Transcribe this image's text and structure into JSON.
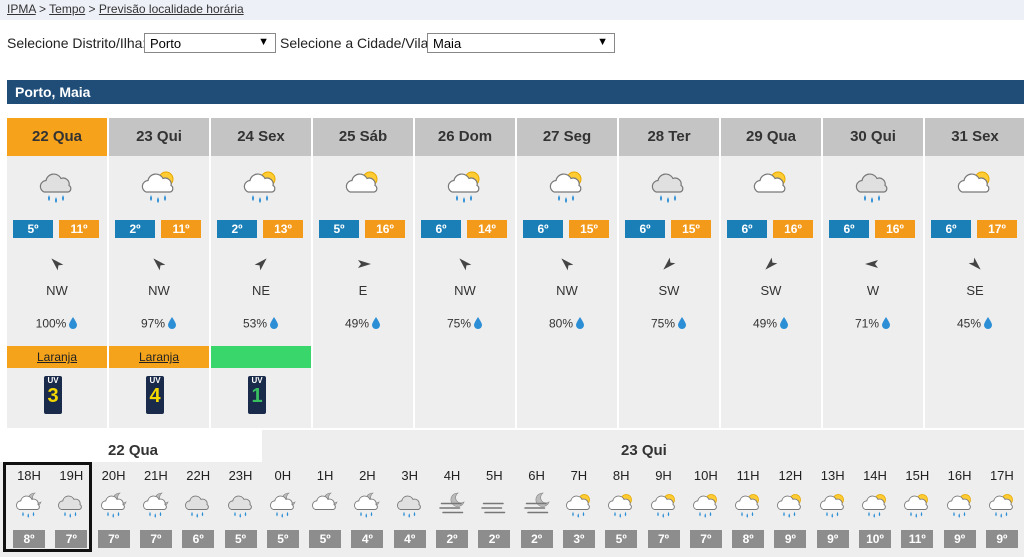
{
  "breadcrumb": {
    "items": [
      "IPMA",
      "Tempo",
      "Previsão localidade horária"
    ],
    "sep": ">"
  },
  "selectors": {
    "district_label": "Selecione Distrito/Ilha:",
    "district_value": "Porto",
    "city_label": "Selecione a Cidade/Vila:",
    "city_value": "Maia"
  },
  "location_title": "Porto, Maia",
  "colors": {
    "header_blue": "#1f4d78",
    "active_day": "#f7a21b",
    "tmin": "#1b7fb7",
    "tmax": "#f49a1b",
    "warn_orange": "#f5a31a",
    "warn_green": "#38d66b"
  },
  "days": [
    {
      "label": "22 Qua",
      "icon": "rain-cloud-icon",
      "tmin": "5º",
      "tmax": "11º",
      "wind_dir": "NW",
      "wind_deg": 315,
      "precip": "100%",
      "warning": "Laranja",
      "warning_color": "orange",
      "uv": "3",
      "uv_color": "#f5d800",
      "active": true
    },
    {
      "label": "23 Qui",
      "icon": "sun-rain-cloud-icon",
      "tmin": "2º",
      "tmax": "11º",
      "wind_dir": "NW",
      "wind_deg": 315,
      "precip": "97%",
      "warning": "Laranja",
      "warning_color": "orange",
      "uv": "4",
      "uv_color": "#f5d800"
    },
    {
      "label": "24 Sex",
      "icon": "sun-rain-cloud-icon",
      "tmin": "2º",
      "tmax": "13º",
      "wind_dir": "NE",
      "wind_deg": 45,
      "precip": "53%",
      "warning": "",
      "warning_color": "green",
      "uv": "1",
      "uv_color": "#38c060"
    },
    {
      "label": "25 Sáb",
      "icon": "sun-cloud-icon",
      "tmin": "5º",
      "tmax": "16º",
      "wind_dir": "E",
      "wind_deg": 90,
      "precip": "49%"
    },
    {
      "label": "26 Dom",
      "icon": "sun-rain-cloud-icon",
      "tmin": "6º",
      "tmax": "14º",
      "wind_dir": "NW",
      "wind_deg": 315,
      "precip": "75%"
    },
    {
      "label": "27 Seg",
      "icon": "sun-rain-cloud-icon",
      "tmin": "6º",
      "tmax": "15º",
      "wind_dir": "NW",
      "wind_deg": 315,
      "precip": "80%"
    },
    {
      "label": "28 Ter",
      "icon": "rain-cloud-icon",
      "tmin": "6º",
      "tmax": "15º",
      "wind_dir": "SW",
      "wind_deg": 225,
      "precip": "75%"
    },
    {
      "label": "29 Qua",
      "icon": "sun-cloud-icon",
      "tmin": "6º",
      "tmax": "16º",
      "wind_dir": "SW",
      "wind_deg": 225,
      "precip": "49%"
    },
    {
      "label": "30 Qui",
      "icon": "rain-cloud-icon",
      "tmin": "6º",
      "tmax": "16º",
      "wind_dir": "W",
      "wind_deg": 270,
      "precip": "71%"
    },
    {
      "label": "31 Sex",
      "icon": "sun-cloud-icon",
      "tmin": "6º",
      "tmax": "17º",
      "wind_dir": "SE",
      "wind_deg": 135,
      "precip": "45%"
    }
  ],
  "hourly_day_labels": [
    "22 Qua",
    "23 Qui"
  ],
  "hours": [
    {
      "label": "18H",
      "icon": "moon-rain-cloud-icon",
      "temp": "8º"
    },
    {
      "label": "19H",
      "icon": "rain-cloud-icon",
      "temp": "7º"
    },
    {
      "label": "20H",
      "icon": "moon-rain-cloud-icon",
      "temp": "7º"
    },
    {
      "label": "21H",
      "icon": "moon-rain-cloud-icon",
      "temp": "7º"
    },
    {
      "label": "22H",
      "icon": "rain-cloud-icon",
      "temp": "6º"
    },
    {
      "label": "23H",
      "icon": "rain-cloud-icon",
      "temp": "5º"
    },
    {
      "label": "0H",
      "icon": "moon-rain-cloud-icon",
      "temp": "5º"
    },
    {
      "label": "1H",
      "icon": "moon-cloud-icon",
      "temp": "5º"
    },
    {
      "label": "2H",
      "icon": "moon-rain-cloud-icon",
      "temp": "4º"
    },
    {
      "label": "3H",
      "icon": "rain-cloud-icon",
      "temp": "4º"
    },
    {
      "label": "4H",
      "icon": "moon-fog-icon",
      "temp": "2º"
    },
    {
      "label": "5H",
      "icon": "fog-icon",
      "temp": "2º"
    },
    {
      "label": "6H",
      "icon": "moon-fog-icon",
      "temp": "2º"
    },
    {
      "label": "7H",
      "icon": "sun-rain-cloud-icon",
      "temp": "3º"
    },
    {
      "label": "8H",
      "icon": "sun-rain-cloud-icon",
      "temp": "5º"
    },
    {
      "label": "9H",
      "icon": "sun-rain-cloud-icon",
      "temp": "7º"
    },
    {
      "label": "10H",
      "icon": "sun-rain-cloud-icon",
      "temp": "7º"
    },
    {
      "label": "11H",
      "icon": "sun-rain-cloud-icon",
      "temp": "8º"
    },
    {
      "label": "12H",
      "icon": "sun-rain-cloud-icon",
      "temp": "9º"
    },
    {
      "label": "13H",
      "icon": "sun-rain-cloud-icon",
      "temp": "9º"
    },
    {
      "label": "14H",
      "icon": "sun-rain-cloud-icon",
      "temp": "10º"
    },
    {
      "label": "15H",
      "icon": "sun-rain-cloud-icon",
      "temp": "11º"
    },
    {
      "label": "16H",
      "icon": "sun-rain-cloud-icon",
      "temp": "9º"
    },
    {
      "label": "17H",
      "icon": "sun-rain-cloud-icon",
      "temp": "9º"
    }
  ]
}
